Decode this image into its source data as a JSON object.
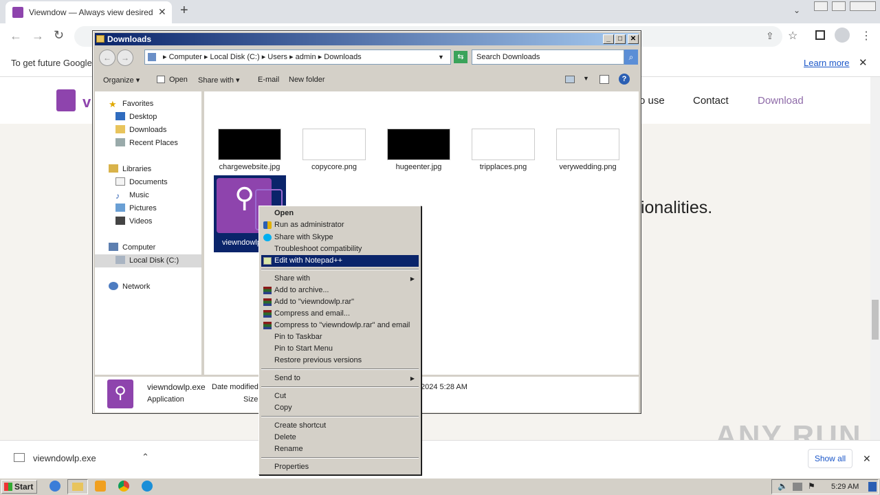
{
  "browser": {
    "tab_title": "Viewndow — Always view desired w",
    "new_tab": "+",
    "infobar_text": "To get future Google",
    "learn_more": "Learn more"
  },
  "site": {
    "nav": [
      "o use",
      "Contact",
      "Download"
    ],
    "hero_fragment": "tionalities."
  },
  "download_bar": {
    "file": "viewndowlp.exe",
    "show_all": "Show all"
  },
  "explorer": {
    "title": "Downloads",
    "breadcrumb": [
      "Computer",
      "Local Disk (C:)",
      "Users",
      "admin",
      "Downloads"
    ],
    "search_placeholder": "Search Downloads",
    "commands": [
      "Organize",
      "Open",
      "Share with",
      "E-mail",
      "New folder"
    ],
    "nav": {
      "favorites": "Favorites",
      "desktop": "Desktop",
      "downloads": "Downloads",
      "recent": "Recent Places",
      "libraries": "Libraries",
      "documents": "Documents",
      "music": "Music",
      "pictures": "Pictures",
      "videos": "Videos",
      "computer": "Computer",
      "localdisk": "Local Disk (C:)",
      "network": "Network"
    },
    "files": [
      "chargewebsite.jpg",
      "copycore.png",
      "hugeenter.jpg",
      "tripplaces.png",
      "verywedding.png",
      "viewndowlp"
    ],
    "details": {
      "name": "viewndowlp.exe",
      "type": "Application",
      "date_label": "Date modified:",
      "size_label": "Size:",
      "date_value": "2024 5:28 AM"
    }
  },
  "context_menu": {
    "open": "Open",
    "run_admin": "Run as administrator",
    "skype": "Share with Skype",
    "troubleshoot": "Troubleshoot compatibility",
    "notepad": "Edit with Notepad++",
    "share_with": "Share with",
    "add_archive": "Add to archive...",
    "add_rar": "Add to \"viewndowlp.rar\"",
    "compress_email": "Compress and email...",
    "compress_rar_email": "Compress to \"viewndowlp.rar\" and email",
    "pin_taskbar": "Pin to Taskbar",
    "pin_start": "Pin to Start Menu",
    "restore": "Restore previous versions",
    "send_to": "Send to",
    "cut": "Cut",
    "copy": "Copy",
    "create_shortcut": "Create shortcut",
    "delete": "Delete",
    "rename": "Rename",
    "properties": "Properties"
  },
  "taskbar": {
    "start": "Start",
    "clock": "5:29 AM"
  },
  "watermark": "ANY RUN",
  "colors": {
    "accent_purple": "#8e44ad",
    "highlight": "#0a246a",
    "title_gradient_end": "#a6caf0"
  }
}
